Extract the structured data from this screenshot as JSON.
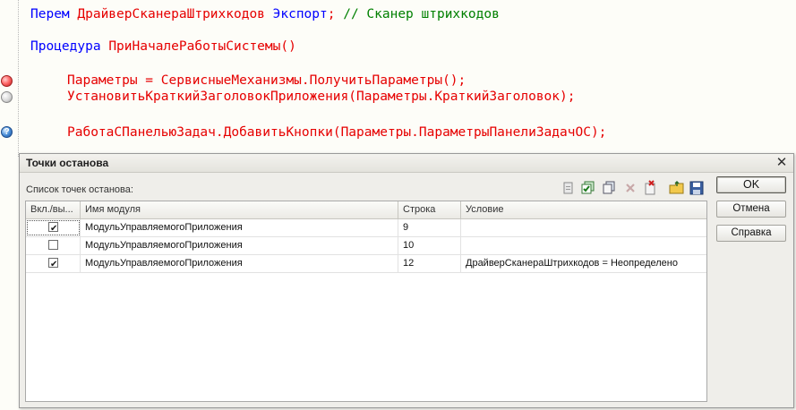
{
  "editor": {
    "line1": {
      "kw": "Перем",
      "name": "ДрайверСканераШтрихкодов",
      "export": "Экспорт",
      "sep": ";",
      "comment": "// Сканер штрихкодов"
    },
    "line2": {
      "kw": "Процедура",
      "name": "ПриНачалеРаботыСистемы",
      "parens": "()"
    },
    "line3": {
      "var": "Параметры",
      "eq": " = ",
      "obj": "СервисныеМеханизмы",
      "dot": ".",
      "method": "ПолучитьПараметры",
      "tail": "();"
    },
    "line4": {
      "method": "УстановитьКраткийЗаголовокПриложения",
      "open": "(",
      "obj": "Параметры",
      "dot": ".",
      "prop": "КраткийЗаголовок",
      "tail": ");"
    },
    "line5": {
      "obj": "РаботаСПанельюЗадач",
      "dot": ".",
      "method": "ДобавитьКнопки",
      "open": "(",
      "arg": "Параметры",
      "dot2": ".",
      "prop": "ПараметрыПанелиЗадачОС",
      "tail": ");"
    },
    "markers": {
      "line3": "breakpoint-icon",
      "line4": "disabled-breakpoint-icon",
      "line5": "conditional-breakpoint-icon",
      "cond_glyph": "?"
    }
  },
  "dialog": {
    "title": "Точки останова",
    "close_glyph": "✕",
    "list_label": "Список точек останова:",
    "toolbar": [
      "add-icon",
      "enable-all-icon",
      "copy-icon",
      "delete-icon",
      "delete-all-icon",
      "open-folder-icon",
      "save-icon"
    ],
    "columns": [
      "Вкл./вы...",
      "Имя модуля",
      "Строка",
      "Условие"
    ],
    "rows": [
      {
        "enabled": true,
        "check_glyph": "✔",
        "module": "МодульУправляемогоПриложения",
        "line": "9",
        "condition": ""
      },
      {
        "enabled": false,
        "check_glyph": "",
        "module": "МодульУправляемогоПриложения",
        "line": "10",
        "condition": ""
      },
      {
        "enabled": true,
        "check_glyph": "✔",
        "module": "МодульУправляемогоПриложения",
        "line": "12",
        "condition": "ДрайверСканераШтрихкодов = Неопределено"
      }
    ],
    "buttons": {
      "ok": "OK",
      "cancel": "Отмена",
      "help": "Справка"
    }
  },
  "colors": {
    "keyword": "#e60000",
    "identifier": "#0000ff",
    "comment": "#008000"
  }
}
